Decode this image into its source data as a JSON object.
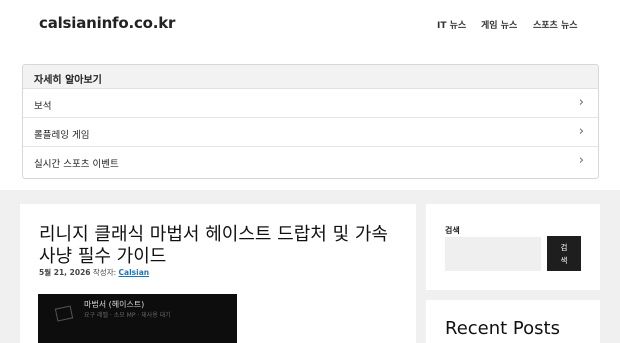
{
  "site": {
    "logo": "calsianinfo.co.kr"
  },
  "nav": [
    {
      "label": "IT 뉴스"
    },
    {
      "label": "게임 뉴스"
    },
    {
      "label": "스포츠 뉴스"
    }
  ],
  "accordion": {
    "title": "자세히 알아보기",
    "items": [
      {
        "label": "보석",
        "icon": "chevron-right-icon"
      },
      {
        "label": "롤플레잉 게임",
        "icon": "chevron-right-icon"
      },
      {
        "label": "실시간 스포츠 이벤트",
        "icon": "chevron-right-icon"
      }
    ]
  },
  "article": {
    "title": "리니지 클래식 마법서 헤이스트 드랍처 및 가속 사냥 필수 가이드",
    "date": "5월 21, 2026",
    "author_prefix": "작성자:",
    "author": "Calsian",
    "thumbnail": {
      "title": "마법서 (헤이스트)",
      "subtitle": "요구 레벨 · 소모 MP · 재사용 대기"
    }
  },
  "sidebar": {
    "search_label": "검색",
    "search_placeholder": "",
    "search_button": "검\n색",
    "recent_posts_title": "Recent Posts"
  }
}
